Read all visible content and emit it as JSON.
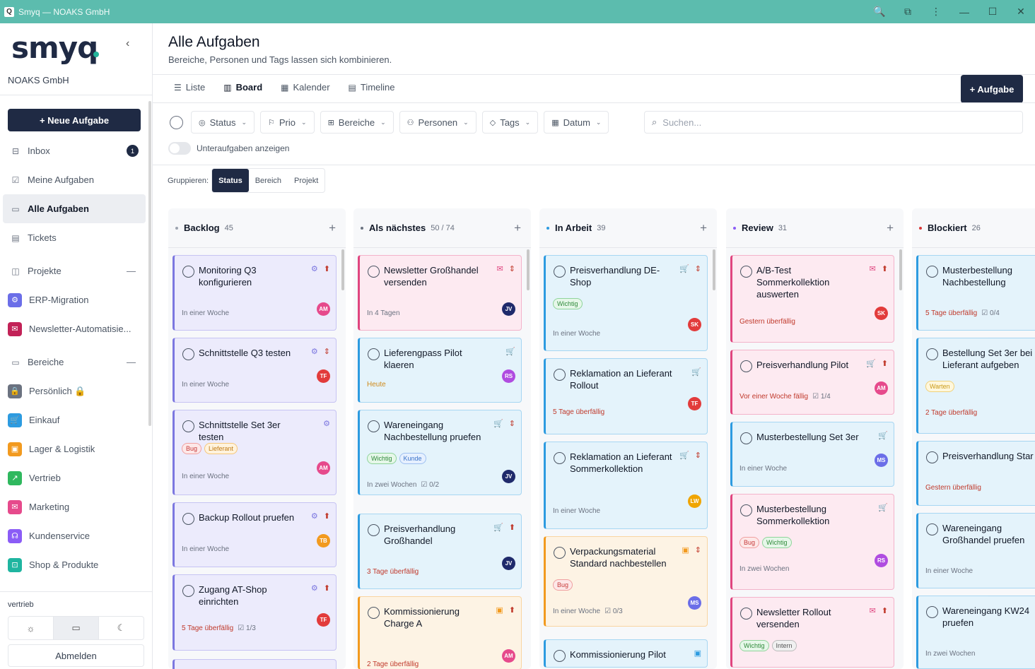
{
  "window": {
    "title": "Smyq — NOAKS GmbH"
  },
  "sidebar": {
    "logo": "smyq",
    "org": "NOAKS GmbH",
    "new_task": "+ Neue Aufgabe",
    "inbox": {
      "label": "Inbox",
      "badge": "1"
    },
    "my_tasks": "Meine Aufgaben",
    "all_tasks": "Alle Aufgaben",
    "tickets": "Tickets",
    "projects_header": "Projekte",
    "projects": [
      "ERP-Migration",
      "Newsletter-Automatisie..."
    ],
    "areas_header": "Bereiche",
    "areas": [
      {
        "label": "Persönlich 🔒",
        "color": "#6b7280"
      },
      {
        "label": "Einkauf",
        "color": "#2d9be0"
      },
      {
        "label": "Lager & Logistik",
        "color": "#f29a1f"
      },
      {
        "label": "Vertrieb",
        "color": "#2fb85e"
      },
      {
        "label": "Marketing",
        "color": "#e64a8c"
      },
      {
        "label": "Kundenservice",
        "color": "#8b5cf6"
      },
      {
        "label": "Shop & Produkte",
        "color": "#1fb5a0"
      }
    ],
    "workspace": "vertrieb",
    "logout": "Abmelden"
  },
  "header": {
    "title": "Alle Aufgaben",
    "subtitle": "Bereiche, Personen und Tags lassen sich kombinieren.",
    "views": [
      "Liste",
      "Board",
      "Kalender",
      "Timeline"
    ],
    "add_task": "+ Aufgabe"
  },
  "filters": {
    "buttons": [
      "Status",
      "Prio",
      "Bereiche",
      "Personen",
      "Tags",
      "Datum"
    ],
    "search_placeholder": "Suchen...",
    "subtasks_label": "Unteraufgaben anzeigen",
    "group_label": "Gruppieren:",
    "group_options": [
      "Status",
      "Bereich",
      "Projekt"
    ]
  },
  "columns": [
    {
      "name": "Backlog",
      "count": "45",
      "dot": "#9ca3af"
    },
    {
      "name": "Als nächstes",
      "count": "50 / 74",
      "dot": "#6b7280"
    },
    {
      "name": "In Arbeit",
      "count": "39",
      "dot": "#2d9be0"
    },
    {
      "name": "Review",
      "count": "31",
      "dot": "#8b5cf6"
    },
    {
      "name": "Blockiert",
      "count": "26",
      "dot": "#d93636"
    }
  ],
  "cards": {
    "c0": [
      {
        "title": "Monitoring Q3 konfigurieren",
        "due": "In einer Woche",
        "av": "AM"
      },
      {
        "title": "Schnittstelle Q3 testen",
        "due": "In einer Woche",
        "av": "TF"
      },
      {
        "title": "Schnittstelle Set 3er testen",
        "tags": [
          "Bug",
          "Lieferant"
        ],
        "due": "In einer Woche",
        "av": "AM"
      },
      {
        "title": "Backup Rollout pruefen",
        "due": "In einer Woche",
        "av": "TB"
      },
      {
        "title": "Zugang AT-Shop einrichten",
        "due": "5 Tage überfällig",
        "sub": "1/3",
        "av": "TF"
      }
    ],
    "c1": [
      {
        "title": "Newsletter Großhandel versenden",
        "due": "In 4 Tagen",
        "av": "JV"
      },
      {
        "title": "Lieferengpass Pilot klaeren",
        "due": "Heute",
        "av": "RS"
      },
      {
        "title": "Wareneingang Nachbestellung pruefen",
        "tags": [
          "Wichtig",
          "Kunde"
        ],
        "due": "In zwei Wochen",
        "sub": "0/2",
        "av": "JV"
      },
      {
        "title": "Preisverhandlung Großhandel",
        "due": "3 Tage überfällig",
        "av": "JV"
      },
      {
        "title": "Kommissionierung Charge A",
        "due": "2 Tage überfällig",
        "av": "AM"
      }
    ],
    "c2": [
      {
        "title": "Preisverhandlung DE-Shop",
        "tags": [
          "Wichtig"
        ],
        "due": "In einer Woche",
        "av": "SK"
      },
      {
        "title": "Reklamation an Lieferant Rollout",
        "due": "5 Tage überfällig",
        "av": "TF"
      },
      {
        "title": "Reklamation an Lieferant Sommerkollektion",
        "due": "In einer Woche",
        "av": "LW"
      },
      {
        "title": "Verpackungsmaterial Standard nachbestellen",
        "tags": [
          "Bug"
        ],
        "due": "In einer Woche",
        "sub": "0/3",
        "av": "MS"
      },
      {
        "title": "Kommissionierung Pilot"
      }
    ],
    "c3": [
      {
        "title": "A/B-Test Sommerkollektion auswerten",
        "due": "Gestern überfällig",
        "av": "SK"
      },
      {
        "title": "Preisverhandlung Pilot",
        "due": "Vor einer Woche fällig",
        "sub": "1/4",
        "av": "AM"
      },
      {
        "title": "Musterbestellung Set 3er",
        "due": "In einer Woche",
        "av": "MS"
      },
      {
        "title": "Musterbestellung Sommerkollektion",
        "tags": [
          "Bug",
          "Wichtig"
        ],
        "due": "In zwei Wochen",
        "av": "RS"
      },
      {
        "title": "Newsletter Rollout versenden",
        "tags": [
          "Wichtig",
          "Intern"
        ]
      }
    ],
    "c4": [
      {
        "title": "Musterbestellung Nachbestellung",
        "due": "5 Tage überfällig",
        "sub": "0/4"
      },
      {
        "title": "Bestellung Set 3er bei Lieferant aufgeben",
        "tags": [
          "Warten"
        ],
        "due": "2 Tage überfällig"
      },
      {
        "title": "Preisverhandlung Star",
        "due": "Gestern überfällig"
      },
      {
        "title": "Wareneingang Großhandel pruefen",
        "due": "In einer Woche"
      },
      {
        "title": "Wareneingang KW24 pruefen",
        "due": "In zwei Wochen"
      }
    ]
  }
}
